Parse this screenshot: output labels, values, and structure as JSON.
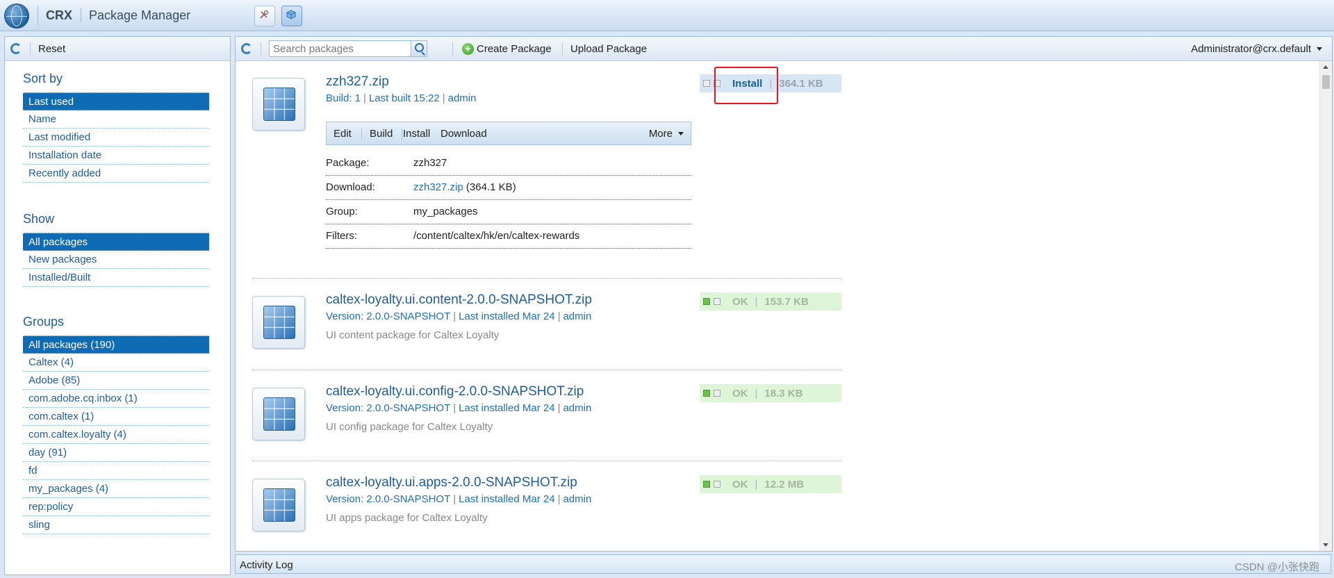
{
  "header": {
    "brand": "CRX",
    "app_name": "Package Manager"
  },
  "left": {
    "reset_label": "Reset",
    "sort": {
      "title": "Sort by",
      "items": [
        "Last used",
        "Name",
        "Last modified",
        "Installation date",
        "Recently added"
      ]
    },
    "show": {
      "title": "Show",
      "items": [
        "All packages",
        "New packages",
        "Installed/Built"
      ]
    },
    "groups": {
      "title": "Groups",
      "items": [
        "All packages (190)",
        "Caltex (4)",
        "Adobe (85)",
        "com.adobe.cq.inbox (1)",
        "com.caltex (1)",
        "com.caltex.loyalty (4)",
        "day (91)",
        "fd",
        "my_packages (4)",
        "rep:policy",
        "sling"
      ]
    }
  },
  "toolbar": {
    "search_placeholder": "Search packages",
    "create_label": "Create Package",
    "upload_label": "Upload Package",
    "user": "Administrator@crx.default"
  },
  "packages": [
    {
      "name": "zzh327.zip",
      "meta_a": "Build: 1",
      "meta_b": "Last built 15:22",
      "meta_c": "admin",
      "status_action": "Install",
      "size": "364.1 KB",
      "actions": [
        "Edit",
        "Build",
        "Install",
        "Download"
      ],
      "more_label": "More",
      "details": {
        "package_key": "Package:",
        "package_val": "zzh327",
        "download_key": "Download:",
        "download_link": "zzh327.zip",
        "download_size": "(364.1 KB)",
        "group_key": "Group:",
        "group_val": "my_packages",
        "filters_key": "Filters:",
        "filters_val": "/content/caltex/hk/en/caltex-rewards"
      }
    },
    {
      "name": "caltex-loyalty.ui.content-2.0.0-SNAPSHOT.zip",
      "meta_a": "Version: 2.0.0-SNAPSHOT",
      "meta_b": "Last installed Mar 24",
      "meta_c": "admin",
      "status": "OK",
      "size": "153.7 KB",
      "description": "UI content package for Caltex Loyalty"
    },
    {
      "name": "caltex-loyalty.ui.config-2.0.0-SNAPSHOT.zip",
      "meta_a": "Version: 2.0.0-SNAPSHOT",
      "meta_b": "Last installed Mar 24",
      "meta_c": "admin",
      "status": "OK",
      "size": "18.3 KB",
      "description": "UI config package for Caltex Loyalty"
    },
    {
      "name": "caltex-loyalty.ui.apps-2.0.0-SNAPSHOT.zip",
      "meta_a": "Version: 2.0.0-SNAPSHOT",
      "meta_b": "Last installed Mar 24",
      "meta_c": "admin",
      "status": "OK",
      "size": "12.2 MB",
      "description": "UI apps package for Caltex Loyalty"
    }
  ],
  "footer": {
    "activity_label": "Activity Log",
    "watermark": "CSDN @小张快跑"
  },
  "colors": {
    "accent": "#1f5c9c",
    "selected_bg": "#0f6cb4",
    "ok_bg": "#dff5d8",
    "highlight": "#e8141c"
  }
}
